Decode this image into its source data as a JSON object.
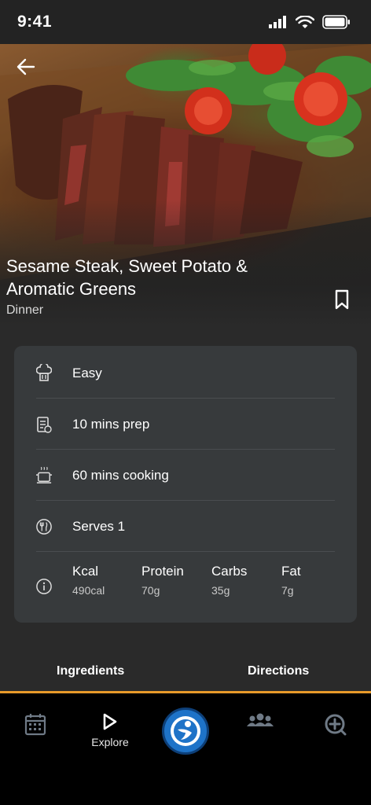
{
  "status_bar": {
    "time": "9:41"
  },
  "recipe": {
    "title": "Sesame Steak, Sweet Potato & Aromatic Greens",
    "category": "Dinner"
  },
  "details": {
    "difficulty": "Easy",
    "prep": "10 mins prep",
    "cooking": "60 mins cooking",
    "serves": "Serves 1"
  },
  "nutrition": [
    {
      "name": "Kcal",
      "value": "490cal"
    },
    {
      "name": "Protein",
      "value": "70g"
    },
    {
      "name": "Carbs",
      "value": "35g"
    },
    {
      "name": "Fat",
      "value": "7g"
    }
  ],
  "tabs": {
    "ingredients": "Ingredients",
    "directions": "Directions"
  },
  "bottom_nav": {
    "explore": "Explore"
  },
  "icons": {
    "back": "arrow-left-icon",
    "bookmark": "bookmark-icon",
    "difficulty": "chef-hat-icon",
    "prep": "clipboard-icon",
    "cooking": "pot-icon",
    "serves": "plate-cutlery-icon",
    "nutrition": "info-icon",
    "calendar": "calendar-icon",
    "explore": "play-icon",
    "home": "brand-logo-icon",
    "community": "people-icon",
    "add": "add-circle-icon"
  },
  "colors": {
    "accent": "#e89a2a",
    "card": "#373a3c",
    "brand": "#1e73c8"
  }
}
